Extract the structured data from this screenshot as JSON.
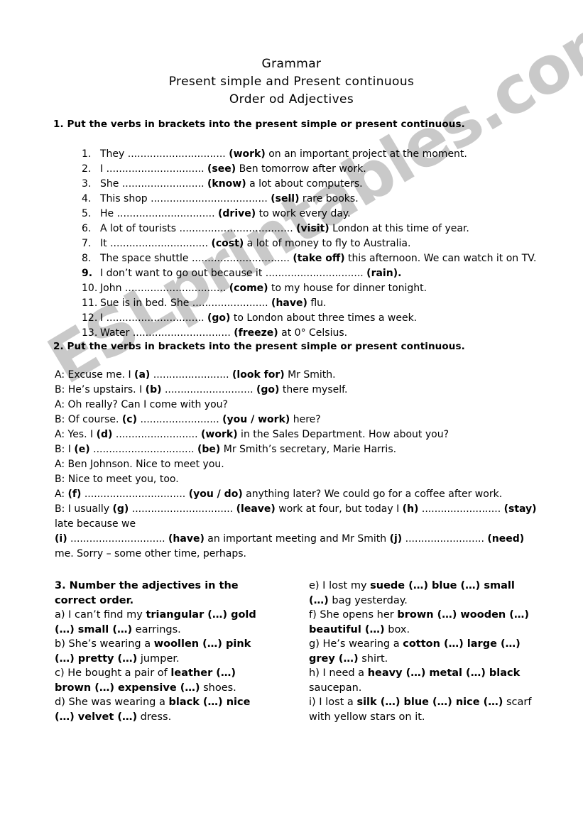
{
  "watermark": {
    "text": "ESLprintables.com",
    "color": "#c9c9c9"
  },
  "titles": [
    "Grammar",
    "Present simple and Present continuous",
    "Order od Adjectives"
  ],
  "exercise1": {
    "heading": "1. Put the verbs in brackets into the present simple or present continuous.",
    "items": [
      {
        "num": "1.",
        "bold_num": false,
        "pre": "They ",
        "dots": "...............................",
        "verb": "(work)",
        "post": " on an important project at the moment."
      },
      {
        "num": "2.",
        "bold_num": false,
        "pre": "I ",
        "dots": "...............................",
        "verb": "(see)",
        "post": " Ben tomorrow after work."
      },
      {
        "num": "3.",
        "bold_num": false,
        "pre": "She ",
        "dots": "..........................",
        "verb": "(know)",
        "post": " a lot about computers."
      },
      {
        "num": "4.",
        "bold_num": false,
        "pre": "This shop ",
        "dots": ".....................................",
        "verb": "(sell)",
        "post": " rare books."
      },
      {
        "num": "5.",
        "bold_num": false,
        "pre": "He ",
        "dots": "...............................",
        "verb": "(drive)",
        "post": " to work every day."
      },
      {
        "num": "6.",
        "bold_num": false,
        "pre": "A lot of tourists ",
        "dots": "....................................",
        "verb": "(visit)",
        "post": " London at this time of year."
      },
      {
        "num": "7.",
        "bold_num": false,
        "pre": "It ",
        "dots": "...............................",
        "verb": "(cost)",
        "post": " a lot of money to fly to Australia."
      },
      {
        "num": "8.",
        "bold_num": false,
        "pre": "The space shuttle ",
        "dots": "...............................",
        "verb": "(take off)",
        "post": " this afternoon. We can watch it on TV."
      },
      {
        "num": "9.",
        "bold_num": true,
        "pre": "I don’t want to go out because it ",
        "dots": "...............................",
        "verb": "(rain).",
        "post": ""
      },
      {
        "num": "10.",
        "bold_num": false,
        "pre": "John ",
        "dots": "................................",
        "verb": "(come)",
        "post": " to my house for dinner tonight."
      },
      {
        "num": "11.",
        "bold_num": false,
        "pre": "Sue is in bed. She ",
        "dots": "........................",
        "verb": "(have)",
        "post": " flu."
      },
      {
        "num": "12.",
        "bold_num": false,
        "pre": "I ",
        "dots": "...............................",
        "verb": "(go)",
        "post": " to London about three times a week."
      },
      {
        "num": "13.",
        "bold_num": false,
        "pre": "Water ",
        "dots": "...............................",
        "verb": "(freeze)",
        "post": " at 0° Celsius."
      }
    ]
  },
  "exercise2": {
    "heading": "2. Put the verbs in brackets into the present simple or present continuous.",
    "lines": [
      {
        "speaker": "A: ",
        "parts": [
          {
            "t": "Excuse me. I ",
            "b": false
          },
          {
            "t": "(a)",
            "b": true
          },
          {
            "t": " ........................ ",
            "b": false
          },
          {
            "t": "(look for)",
            "b": true
          },
          {
            "t": " Mr Smith.",
            "b": false
          }
        ]
      },
      {
        "speaker": "B: ",
        "parts": [
          {
            "t": "He’s upstairs. I ",
            "b": false
          },
          {
            "t": "(b)",
            "b": true
          },
          {
            "t": " ............................ ",
            "b": false
          },
          {
            "t": "(go)",
            "b": true
          },
          {
            "t": " there myself.",
            "b": false
          }
        ]
      },
      {
        "speaker": "A: ",
        "parts": [
          {
            "t": "Oh really? Can I come with you?",
            "b": false
          }
        ]
      },
      {
        "speaker": "B: ",
        "parts": [
          {
            "t": "Of course. ",
            "b": false
          },
          {
            "t": "(c)",
            "b": true
          },
          {
            "t": " ......................... ",
            "b": false
          },
          {
            "t": "(you / work)",
            "b": true
          },
          {
            "t": " here?",
            "b": false
          }
        ]
      },
      {
        "speaker": "A: ",
        "parts": [
          {
            "t": "Yes. I ",
            "b": false
          },
          {
            "t": "(d)",
            "b": true
          },
          {
            "t": " .......................... ",
            "b": false
          },
          {
            "t": "(work)",
            "b": true
          },
          {
            "t": " in the Sales Department. How about you?",
            "b": false
          }
        ]
      },
      {
        "speaker": "B: ",
        "parts": [
          {
            "t": "I ",
            "b": false
          },
          {
            "t": "(e)",
            "b": true
          },
          {
            "t": " ................................ ",
            "b": false
          },
          {
            "t": "(be)",
            "b": true
          },
          {
            "t": " Mr Smith’s secretary, Marie Harris.",
            "b": false
          }
        ]
      },
      {
        "speaker": "A: ",
        "parts": [
          {
            "t": "Ben Johnson. Nice to meet you.",
            "b": false
          }
        ]
      },
      {
        "speaker": "B: ",
        "parts": [
          {
            "t": "Nice to meet you, too.",
            "b": false
          }
        ]
      },
      {
        "speaker": "A: ",
        "parts": [
          {
            "t": "(f)",
            "b": true
          },
          {
            "t": " ................................ ",
            "b": false
          },
          {
            "t": "(you / do)",
            "b": true
          },
          {
            "t": " anything later? We could go for a coffee after work.",
            "b": false
          }
        ]
      },
      {
        "speaker": "B: ",
        "parts": [
          {
            "t": "I usually ",
            "b": false
          },
          {
            "t": "(g)",
            "b": true
          },
          {
            "t": " ................................ ",
            "b": false
          },
          {
            "t": "(leave)",
            "b": true
          },
          {
            "t": " work at four, but today I ",
            "b": false
          },
          {
            "t": "(h)",
            "b": true
          },
          {
            "t": " ......................... ",
            "b": false
          },
          {
            "t": "(stay)",
            "b": true
          },
          {
            "t": " late because we",
            "b": false
          }
        ]
      },
      {
        "speaker": "",
        "parts": [
          {
            "t": "(i)",
            "b": true
          },
          {
            "t": " .............................. ",
            "b": false
          },
          {
            "t": "(have)",
            "b": true
          },
          {
            "t": " an important meeting and Mr Smith ",
            "b": false
          },
          {
            "t": "(j)",
            "b": true
          },
          {
            "t": " ......................... ",
            "b": false
          },
          {
            "t": "(need)",
            "b": true
          },
          {
            "t": " me. Sorry – some other time, perhaps.",
            "b": false
          }
        ]
      }
    ]
  },
  "exercise3": {
    "heading": "3. Number the adjectives in the correct order.",
    "left": [
      {
        "parts": [
          {
            "t": "a) I can’t find my ",
            "b": false
          },
          {
            "t": "triangular (…) gold (…) small (…)",
            "b": true
          },
          {
            "t": " earrings.",
            "b": false
          }
        ]
      },
      {
        "parts": [
          {
            "t": "b) She’s wearing a ",
            "b": false
          },
          {
            "t": "woollen (…) pink (…) pretty (…)",
            "b": true
          },
          {
            "t": " jumper.",
            "b": false
          }
        ]
      },
      {
        "parts": [
          {
            "t": "c) He bought a pair of ",
            "b": false
          },
          {
            "t": "leather (…) brown (…) expensive (…)",
            "b": true
          },
          {
            "t": " shoes.",
            "b": false
          }
        ]
      },
      {
        "parts": [
          {
            "t": "d) She was wearing a ",
            "b": false
          },
          {
            "t": "black (…) nice (…) velvet (…)",
            "b": true
          },
          {
            "t": " dress.",
            "b": false
          }
        ]
      }
    ],
    "right": [
      {
        "parts": [
          {
            "t": "e) I lost my ",
            "b": false
          },
          {
            "t": "suede (…) blue (…) small (…)",
            "b": true
          },
          {
            "t": " bag yesterday.",
            "b": false
          }
        ]
      },
      {
        "parts": [
          {
            "t": "f) She opens her ",
            "b": false
          },
          {
            "t": "brown (…) wooden (…) beautiful (…)",
            "b": true
          },
          {
            "t": " box.",
            "b": false
          }
        ]
      },
      {
        "parts": [
          {
            "t": "g) He’s wearing a ",
            "b": false
          },
          {
            "t": "cotton (…) large (…) grey (…)",
            "b": true
          },
          {
            "t": " shirt.",
            "b": false
          }
        ]
      },
      {
        "parts": [
          {
            "t": "h) I need a ",
            "b": false
          },
          {
            "t": "heavy (…) metal (…) black",
            "b": true
          },
          {
            "t": " saucepan.",
            "b": false
          }
        ]
      },
      {
        "parts": [
          {
            "t": "i) I lost a ",
            "b": false
          },
          {
            "t": "silk (…) blue (…) nice (…)",
            "b": true
          },
          {
            "t": " scarf with yellow stars on it.",
            "b": false
          }
        ]
      }
    ]
  }
}
